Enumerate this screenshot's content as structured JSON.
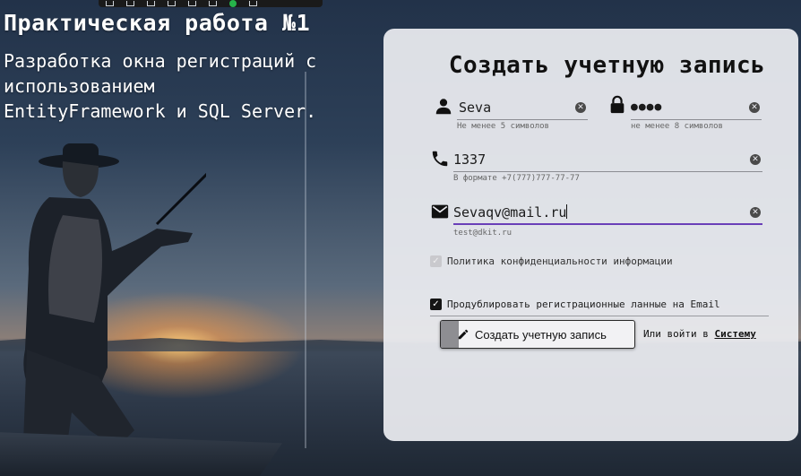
{
  "header": {
    "title": "Практическая работа №1",
    "subtitle": "Разработка окна регистраций с\nиспользованием\nEntityFramework и SQL Server."
  },
  "form": {
    "title": "Создать учетную запись",
    "username": {
      "value": "Seva",
      "hint": "Не менее 5 символов",
      "icon": "person-icon"
    },
    "password": {
      "value": "●●●●",
      "hint": "не менее 8 символов",
      "icon": "lock-icon"
    },
    "phone": {
      "value": "1337",
      "hint": "В формате +7(777)777-77-77",
      "icon": "phone-icon"
    },
    "email": {
      "value": "Sevaqv@mail.ru",
      "hint": "test@dkit.ru",
      "icon": "mail-icon"
    },
    "privacy_label": "Политика конфиденциальности информации",
    "duplicate_label": "Продублировать регистрационные ланные на Email",
    "create_button": "Создать учетную запись",
    "login_prefix": "Или войти в",
    "login_link": "Систему"
  },
  "colors": {
    "card": "#ecedf1",
    "active_underline": "#6a3fb8",
    "text": "#111111"
  }
}
